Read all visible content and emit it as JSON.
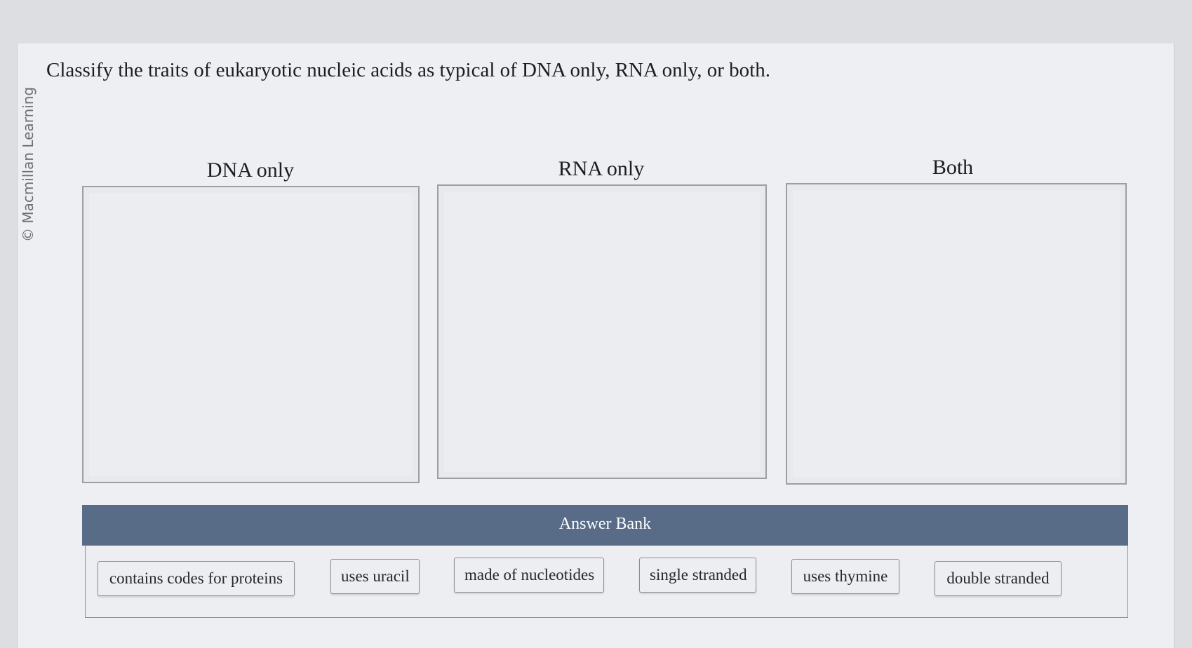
{
  "credit": "© Macmillan Learning",
  "question": "Classify the traits of eukaryotic nucleic acids as typical of DNA only, RNA only, or both.",
  "bins": [
    {
      "label": "DNA only"
    },
    {
      "label": "RNA only"
    },
    {
      "label": "Both"
    }
  ],
  "answer_bank": {
    "title": "Answer Bank",
    "items": [
      "contains codes for proteins",
      "uses uracil",
      "made of nucleotides",
      "single stranded",
      "uses thymine",
      "double stranded"
    ]
  },
  "colors": {
    "bank_header": "#586c88",
    "background": "#eeeff2"
  }
}
